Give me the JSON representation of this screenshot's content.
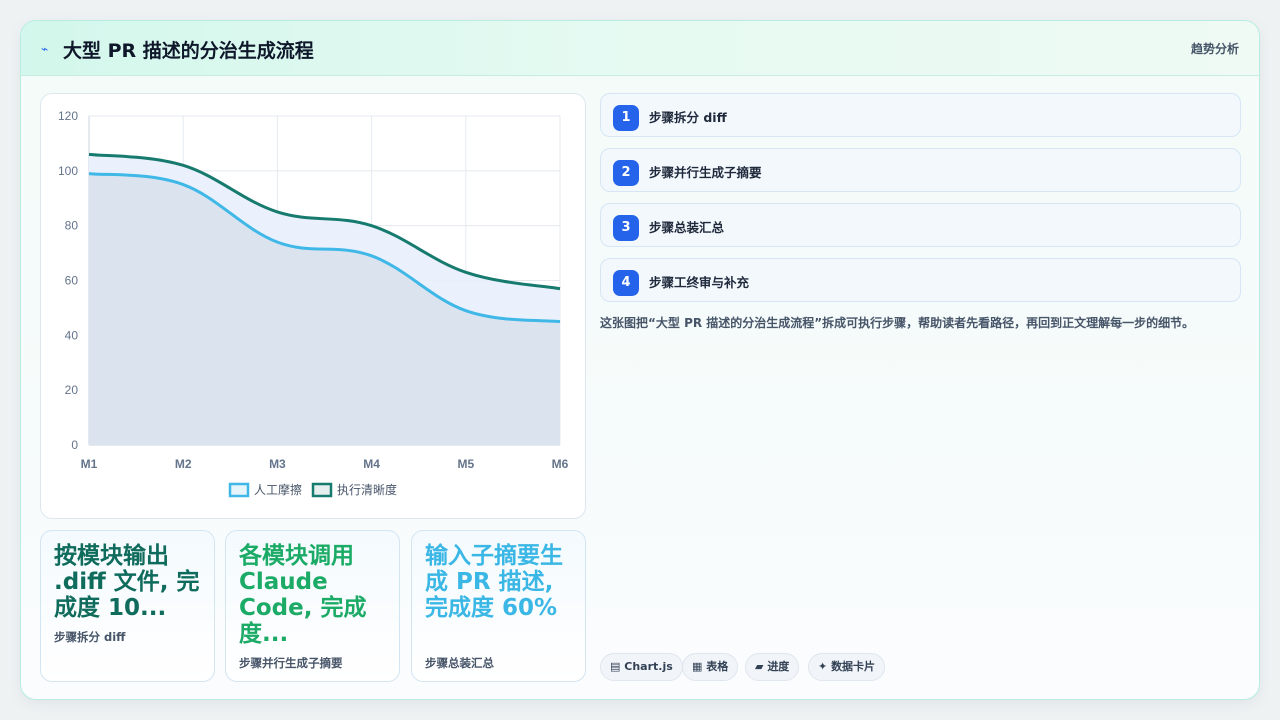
{
  "header": {
    "icon": "chart-trend-icon",
    "title": "大型 PR 描述的分治生成流程",
    "link": "趋势分析"
  },
  "chart_data": {
    "type": "area",
    "categories": [
      "M1",
      "M2",
      "M3",
      "M4",
      "M5",
      "M6"
    ],
    "ylim": [
      0,
      120
    ],
    "yticks": [
      0,
      20,
      40,
      60,
      80,
      100,
      120
    ],
    "grid": true,
    "legend_position": "bottom",
    "series": [
      {
        "name": "人工摩擦",
        "values": [
          99,
          95,
          74,
          69,
          49,
          45
        ],
        "color": "#3fb8e8",
        "fill": "#dbe3ef"
      },
      {
        "name": "执行清晰度",
        "values": [
          106,
          102,
          85,
          80,
          63,
          57
        ],
        "color": "#177a6e",
        "fill": "#e8effc"
      }
    ]
  },
  "steps": [
    {
      "num": "1",
      "label": "步骤拆分 diff"
    },
    {
      "num": "2",
      "label": "步骤并行生成子摘要"
    },
    {
      "num": "3",
      "label": "步骤总装汇总"
    },
    {
      "num": "4",
      "label": "步骤工终审与补充"
    }
  ],
  "description": "这张图把“大型 PR 描述的分治生成流程”拆成可执行步骤，帮助读者先看路径，再回到正文理解每一步的细节。",
  "stats": [
    {
      "value": "按模块输出 .diff 文件, 完成度 10...",
      "label": "步骤拆分 diff",
      "color": "#0f6b5c"
    },
    {
      "value": "各模块调用 Claude Code, 完成度...",
      "label": "步骤并行生成子摘要",
      "color": "#1bab66"
    },
    {
      "value": "输入子摘要生成 PR 描述, 完成度 60%",
      "label": "步骤总装汇总",
      "color": "#3bb7e6"
    }
  ],
  "tags": [
    {
      "icon": "chart-icon",
      "glyph": "▤",
      "label": "Chart.js"
    },
    {
      "icon": "table-icon",
      "glyph": "▦",
      "label": "表格"
    },
    {
      "icon": "progress-icon",
      "glyph": "▰",
      "label": "进度"
    },
    {
      "icon": "sparkle-icon",
      "glyph": "✦",
      "label": "数据卡片"
    }
  ]
}
